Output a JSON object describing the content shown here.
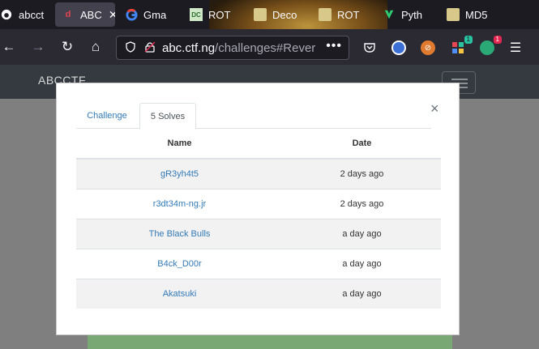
{
  "browser": {
    "tabs": [
      {
        "label": "abcct",
        "icon": "github-icon",
        "active": false
      },
      {
        "label": "ABC",
        "icon": "ctf-favicon-icon",
        "active": true
      },
      {
        "label": "Gma",
        "icon": "google-icon",
        "active": false
      },
      {
        "label": "ROT",
        "icon": "dcode-icon",
        "active": false
      },
      {
        "label": "Deco",
        "icon": "decoder-icon",
        "active": false
      },
      {
        "label": "ROT",
        "icon": "decoder-icon",
        "active": false
      },
      {
        "label": "Pyth",
        "icon": "trinket-icon",
        "active": false
      },
      {
        "label": "MD5",
        "icon": "decoder-icon",
        "active": false
      }
    ],
    "url_host": "abc.ctf.ng",
    "url_path": "/challenges#Rever",
    "extension_badges": {
      "green": "1",
      "red": "1"
    }
  },
  "site": {
    "brand": "ABCCTF"
  },
  "modal": {
    "tabs": [
      "Challenge",
      "5 Solves"
    ],
    "active_tab": "5 Solves",
    "columns": [
      "Name",
      "Date"
    ],
    "rows": [
      {
        "name": "gR3yh4t5",
        "date": "2 days ago"
      },
      {
        "name": "r3dt34m-ng.jr",
        "date": "2 days ago"
      },
      {
        "name": "The Black Bulls",
        "date": "a day ago"
      },
      {
        "name": "B4ck_D00r",
        "date": "a day ago"
      },
      {
        "name": "Akatsuki",
        "date": "a day ago"
      }
    ]
  }
}
